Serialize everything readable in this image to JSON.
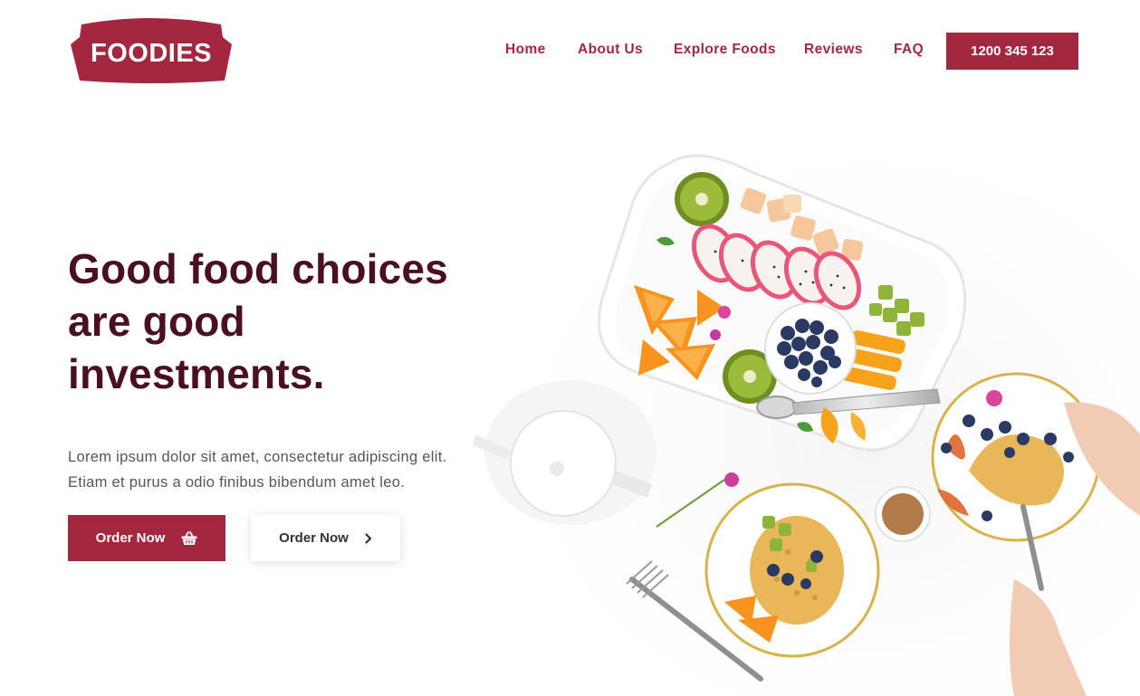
{
  "brand": {
    "logo_text": "FOODIES"
  },
  "nav": {
    "items": [
      "Home",
      "About Us",
      "Explore Foods",
      "Reviews",
      "FAQ"
    ],
    "phone": "1200 345 123"
  },
  "hero": {
    "headline": [
      "Good food choices",
      "are good",
      "investments."
    ],
    "description": [
      "Lorem ipsum dolor sit amet, consectetur adipiscing elit.",
      "Etiam et purus a odio finibus bibendum amet leo."
    ],
    "primary_button": {
      "label": "Order Now",
      "icon": "basket-icon"
    },
    "secondary_button": {
      "label": "Order Now",
      "icon": "chevron-right-icon"
    }
  },
  "colors": {
    "brand": "#a3283f",
    "headline": "#4a1020",
    "body_text": "#555555"
  }
}
